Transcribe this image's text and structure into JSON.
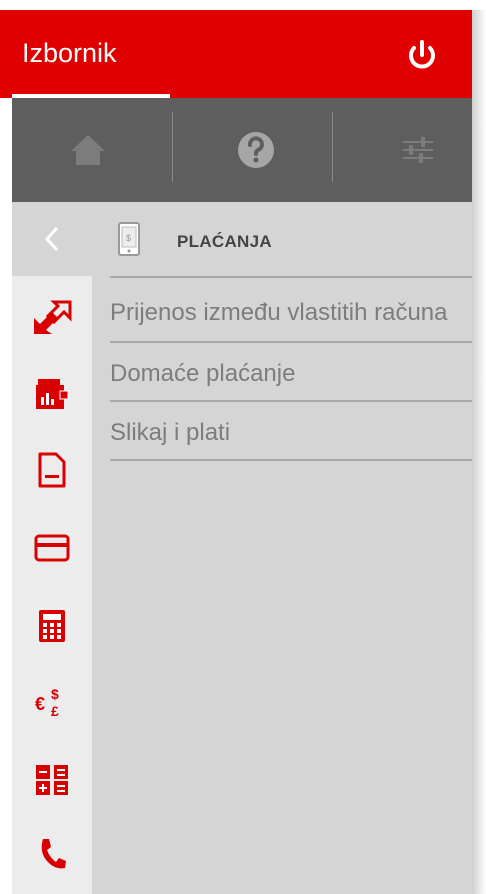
{
  "header": {
    "title": "Izbornik"
  },
  "section": {
    "title": "PLAĆANJA"
  },
  "menu": {
    "items": [
      {
        "label": "Prijenos između vlastitih računa"
      },
      {
        "label": "Domaće plaćanje"
      },
      {
        "label": "Slikaj i plati"
      }
    ]
  },
  "rail": {
    "icons": [
      "transfer-icon",
      "wallet-icon",
      "document-icon",
      "card-icon",
      "calculator-icon",
      "currency-icon",
      "calculator-grid-icon",
      "phone-icon"
    ]
  },
  "colors": {
    "accent": "#e00000",
    "navbar": "#5e5e5e",
    "content": "#d5d5d5",
    "rail": "#ececec"
  }
}
